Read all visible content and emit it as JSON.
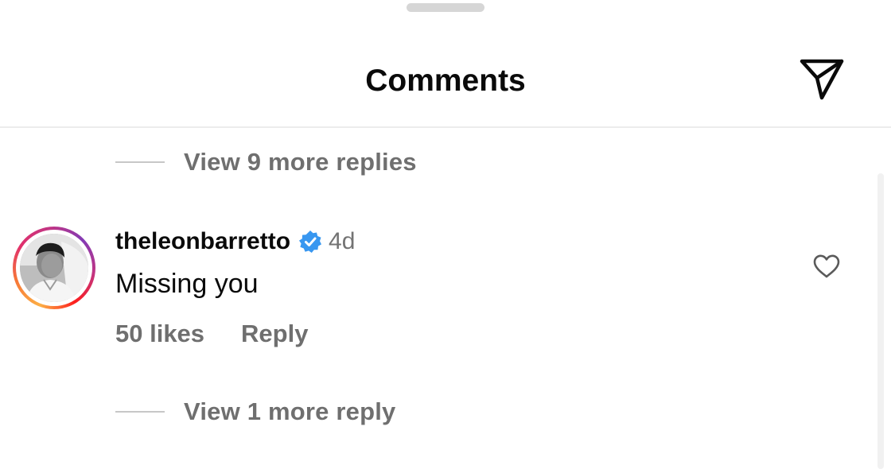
{
  "header": {
    "title": "Comments",
    "share_icon": "send-paper-plane-icon"
  },
  "thread": {
    "view_more_top": "View 9 more replies",
    "view_more_bottom": "View 1 more reply"
  },
  "comment": {
    "username": "theleonbarretto",
    "verified": true,
    "verified_icon": "verified-badge-icon",
    "timestamp": "4d",
    "text": "Missing you",
    "likes": "50 likes",
    "reply_label": "Reply",
    "like_icon": "heart-outline-icon"
  },
  "colors": {
    "primary_text": "#0a0a0a",
    "secondary_text": "#6f6f6f",
    "verified_blue": "#3897f0",
    "divider": "#ececec"
  }
}
